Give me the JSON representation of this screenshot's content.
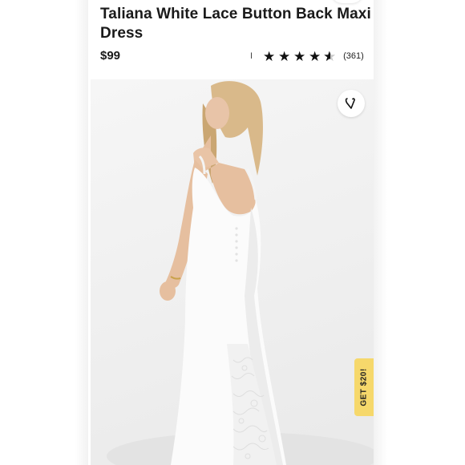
{
  "product": {
    "title": "Taliana White Lace Button Back Maxi Dress",
    "price": "$99",
    "rating_separator": "I",
    "rating_value": 4.5,
    "review_count": "(361)"
  },
  "promo_tab": "GET $20!",
  "icons": {
    "wishlist": "heart-icon",
    "star": "star-icon"
  },
  "colors": {
    "promo_bg": "#f6d86b",
    "text": "#1a1a1a",
    "image_bg": "#efefef"
  }
}
